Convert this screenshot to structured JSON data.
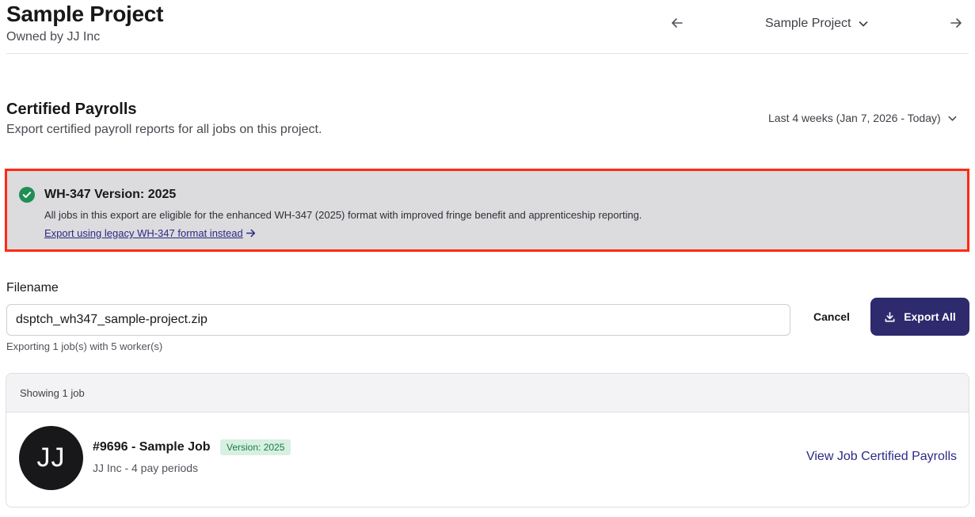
{
  "header": {
    "title": "Sample Project",
    "owner": "Owned by JJ Inc",
    "project_switcher": "Sample Project"
  },
  "section": {
    "title": "Certified Payrolls",
    "subtitle": "Export certified payroll reports for all jobs on this project.",
    "date_range": "Last 4 weeks (Jan 7, 2026 - Today)"
  },
  "banner": {
    "title": "WH-347 Version: 2025",
    "text": "All jobs in this export are eligible for the enhanced WH-347 (2025) format with improved fringe benefit and apprenticeship reporting.",
    "link": "Export using legacy WH-347 format instead"
  },
  "export": {
    "filename_label": "Filename",
    "filename_value": "dsptch_wh347_sample-project.zip",
    "hint": "Exporting 1 job(s) with 5 worker(s)",
    "cancel_label": "Cancel",
    "export_label": "Export All"
  },
  "jobs": {
    "showing": "Showing 1 job",
    "items": [
      {
        "avatar_initials": "JJ",
        "title": "#9696 - Sample Job",
        "badge": "Version: 2025",
        "subtitle": "JJ Inc - 4 pay periods",
        "link": "View Job Certified Payrolls"
      }
    ]
  },
  "colors": {
    "primary": "#2e2a6e",
    "link": "#2b2a86",
    "success": "#1f8f55",
    "highlight_border": "#ff2a12",
    "banner_bg": "#dcdbde"
  },
  "icons": {
    "prev": "arrow-left-icon",
    "next": "arrow-right-icon",
    "dropdown": "chevron-down-icon",
    "success": "check-circle-icon",
    "download": "download-icon",
    "link_arrow": "arrow-right-icon"
  }
}
